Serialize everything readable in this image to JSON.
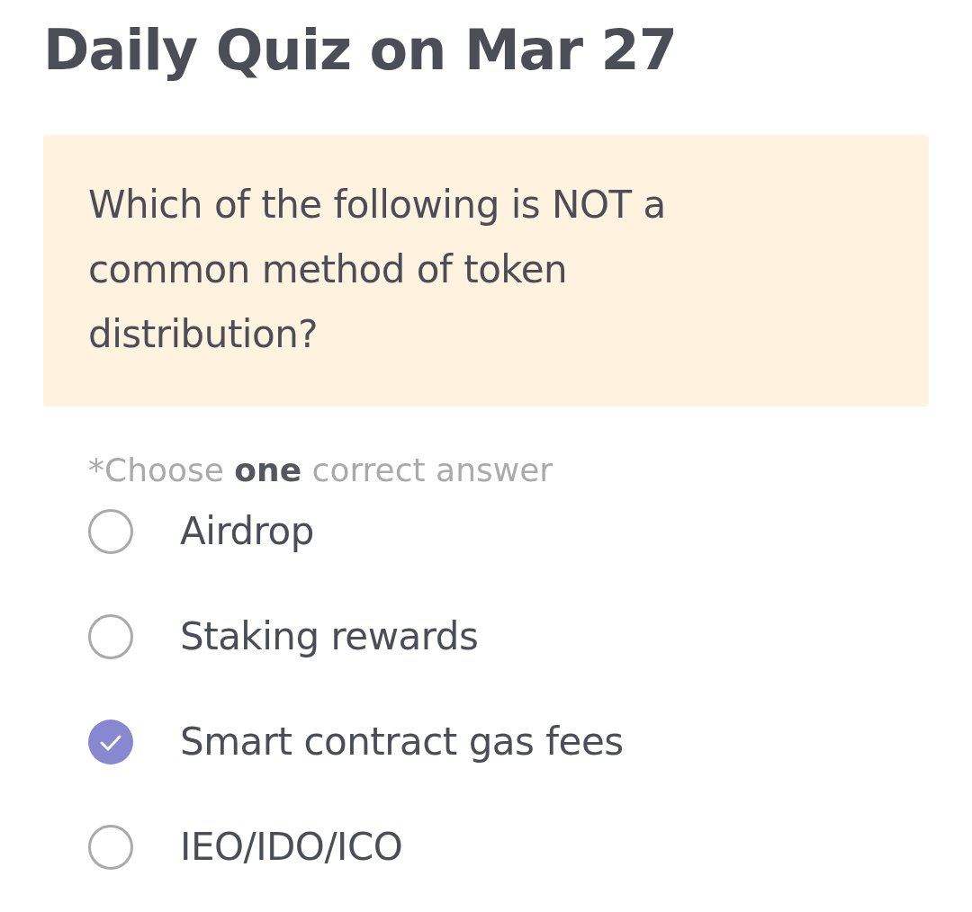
{
  "title": "Daily Quiz on Mar 27",
  "question": "Which of the following is NOT a common method of token distribution?",
  "hint": "*Choose **one** correct answer",
  "options": [
    {
      "label": "Airdrop",
      "selected": false
    },
    {
      "label": "Staking rewards",
      "selected": false
    },
    {
      "label": "Smart contract gas fees",
      "selected": true
    },
    {
      "label": "IEO/IDO/ICO",
      "selected": false
    }
  ]
}
